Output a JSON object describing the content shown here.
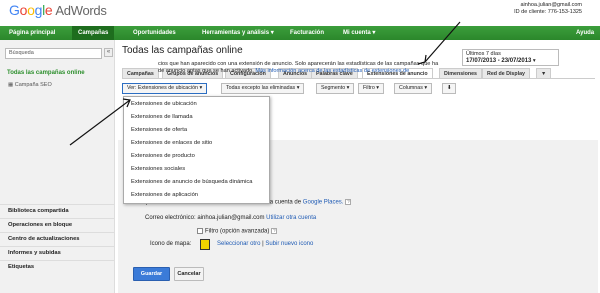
{
  "header": {
    "logo_google": [
      "G",
      "o",
      "o",
      "g",
      "l",
      "e"
    ],
    "logo_product": "AdWords",
    "account_email": "ainhoa.julian@gmail.com",
    "client_id": "ID de cliente: 776-153-1325"
  },
  "nav": {
    "items": [
      "Página principal",
      "Campañas",
      "Oportunidades",
      "Herramientas y análisis",
      "Facturación",
      "Mi cuenta"
    ],
    "help": "Ayuda"
  },
  "sidebar": {
    "search_placeholder": "Búsqueda",
    "collapse": "«",
    "all_campaigns": "Todas las campañas online",
    "campaign": "Campaña SEO",
    "links": [
      "Biblioteca compartida",
      "Operaciones en bloque",
      "Centro de actualizaciones",
      "Informes y subidas",
      "Etiquetas"
    ]
  },
  "main": {
    "title": "Todas las campañas online",
    "date_label": "Últimos 7 días",
    "date_range": "17/07/2013 - 23/07/2013",
    "tabs": [
      "Campañas",
      "Grupos de anuncios",
      "Configuración",
      "Anuncios",
      "Palabras clave",
      "Extensiones de anuncio",
      "Dimensiones",
      "Red de Display"
    ],
    "tabs_more": "▼",
    "filters": {
      "view": "Ver: Extensiones de ubicación",
      "status": "Todas excepto las eliminadas",
      "segment": "Segmento",
      "filter": "Filtro",
      "columns": "Columnas",
      "download": "⬇"
    },
    "description": "cios que han aparecido con una extensión de anuncio. Solo aparecerán las estadísticas de las campañas que ha",
    "description2": "de anuncio aptas que se han activado.",
    "description_link": "Más información acerca de las estadísticas de extensiones de",
    "dropdown_items": [
      "Extensiones de ubicación",
      "Extensiones de llamada",
      "Extensiones de oferta",
      "Extensiones de enlaces de sitio",
      "Extensiones de producto",
      "Extensiones sociales",
      "Extensiones de anuncio de búsqueda dinámica",
      "Extensiones de aplicación"
    ]
  },
  "form": {
    "places_text": "Ampliación de los anuncios con direcciones de una cuenta de ",
    "places_link": "Google Places.",
    "help": "?",
    "email_label": "Correo electrónico:",
    "email_value": "ainhoa.julian@gmail.com",
    "email_link": "Utilizar otra cuenta",
    "filter_label": "Filtro (opción avanzada)",
    "map_icon_label": "Icono de mapa:",
    "map_select": "Seleccionar otro",
    "map_sep": " | ",
    "map_upload": "Subir nuevo icono",
    "save": "Guardar",
    "cancel": "Cancelar"
  }
}
